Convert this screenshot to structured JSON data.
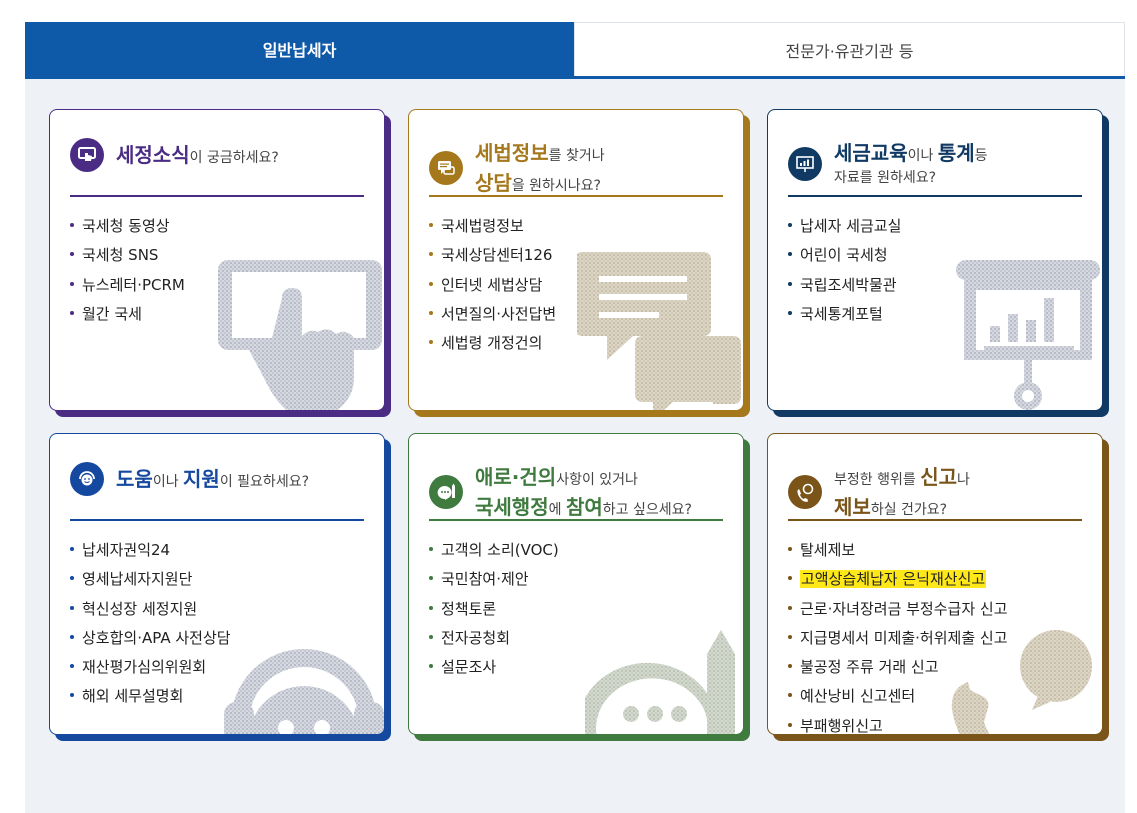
{
  "tabs": [
    {
      "label": "일반납세자",
      "active": true
    },
    {
      "label": "전문가·유관기관 등",
      "active": false
    }
  ],
  "colors": {
    "tab_active": "#0f5aa8",
    "purple": "#4b2c84",
    "gold": "#a5781b",
    "navy": "#103a63",
    "blue": "#1549a0",
    "green": "#3f7a3f",
    "brown": "#7a5418"
  },
  "cards": [
    {
      "icon": "tablet-touch-icon",
      "title": {
        "strong1": "세정소식",
        "text1": "이 궁금하세요?"
      },
      "items": [
        "국세청 동영상",
        "국세청 SNS",
        "뉴스레터·PCRM",
        "월간 국세"
      ]
    },
    {
      "icon": "chat-bubble-icon",
      "title": {
        "strong1": "세법정보",
        "text1": "를 찾거나",
        "strong2": "상담",
        "text2": "을 원하시나요?"
      },
      "items": [
        "국세법령정보",
        "국세상담센터126",
        "인터넷 세법상담",
        "서면질의·사전답변",
        "세법령 개정건의"
      ]
    },
    {
      "icon": "presentation-board-icon",
      "title": {
        "strong1": "세금교육",
        "text1": "이나 ",
        "strong2": "통계",
        "text2": "등",
        "text3": "자료를 원하세요?"
      },
      "items": [
        "납세자 세금교실",
        "어린이 국세청",
        "국립조세박물관",
        "국세통계포털"
      ]
    },
    {
      "icon": "headset-smile-icon",
      "title": {
        "strong1": "도움",
        "text1": "이나 ",
        "strong2": "지원",
        "text2": "이 필요하세요?"
      },
      "items": [
        "납세자권익24",
        "영세납세자지원단",
        "혁신성장 세정지원",
        "상호합의·APA 사전상담",
        "재산평가심의위원회",
        "해외 세무설명회"
      ]
    },
    {
      "icon": "speech-pencil-icon",
      "title": {
        "strong1": "애로·건의",
        "text1": "사항이 있거나",
        "strong2": "국세행정",
        "text2": "에 ",
        "strong3": "참여",
        "text3": "하고 싶으세요?"
      },
      "items": [
        "고객의 소리(VOC)",
        "국민참여·제안",
        "정책토론",
        "전자공청회",
        "설문조사"
      ]
    },
    {
      "icon": "phone-report-icon",
      "title": {
        "text0": "부정한 행위를 ",
        "strong1": "신고",
        "text1": "나",
        "strong2": "제보",
        "text2": "하실 건가요?"
      },
      "items": [
        "탈세제보",
        "고액상습체납자 은닉재산신고",
        "근로·자녀장려금 부정수급자 신고",
        "지급명세서 미제출·허위제출 신고",
        "불공정 주류 거래 신고",
        "예산낭비 신고센터",
        "부패행위신고"
      ],
      "highlight_item": "고액상습체납자 은닉재산신고"
    }
  ]
}
